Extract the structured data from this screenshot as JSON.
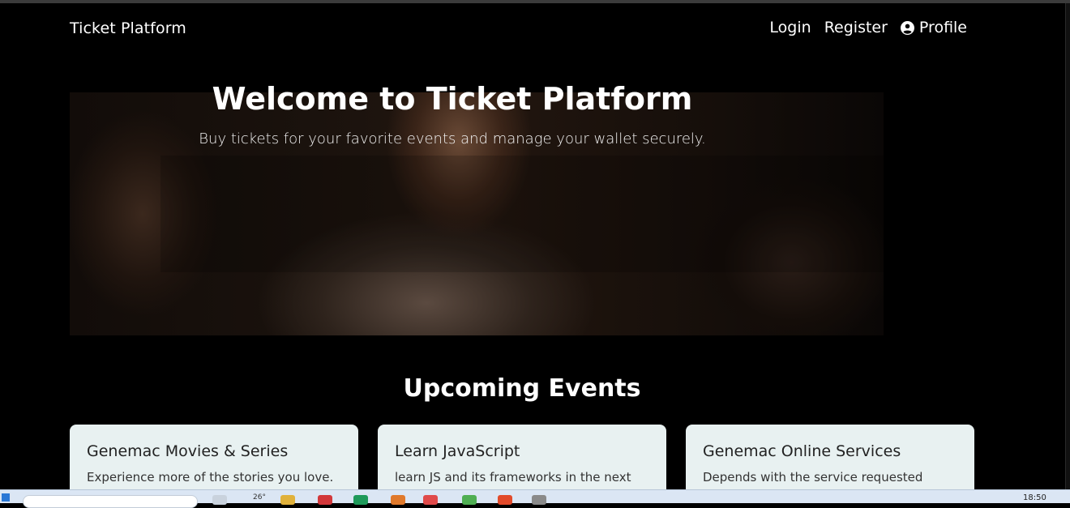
{
  "navbar": {
    "brand": "Ticket Platform",
    "links": {
      "login": "Login",
      "register": "Register",
      "profile": "Profile"
    }
  },
  "hero": {
    "title": "Welcome to Ticket Platform",
    "subtitle": "Buy tickets for your favorite events and manage your wallet securely."
  },
  "events": {
    "heading": "Upcoming Events",
    "cards": [
      {
        "title": "Genemac Movies & Series",
        "text": "Experience more of the stories you love."
      },
      {
        "title": "Learn JavaScript",
        "text": "learn JS and its frameworks in the next"
      },
      {
        "title": "Genemac Online Services",
        "text": "Depends with the service requested"
      }
    ]
  },
  "taskbar": {
    "weather": "26°",
    "clock": "18:50"
  },
  "colors": {
    "background": "#000000",
    "card_background": "#e8f1f1",
    "text_primary": "#ffffff"
  }
}
